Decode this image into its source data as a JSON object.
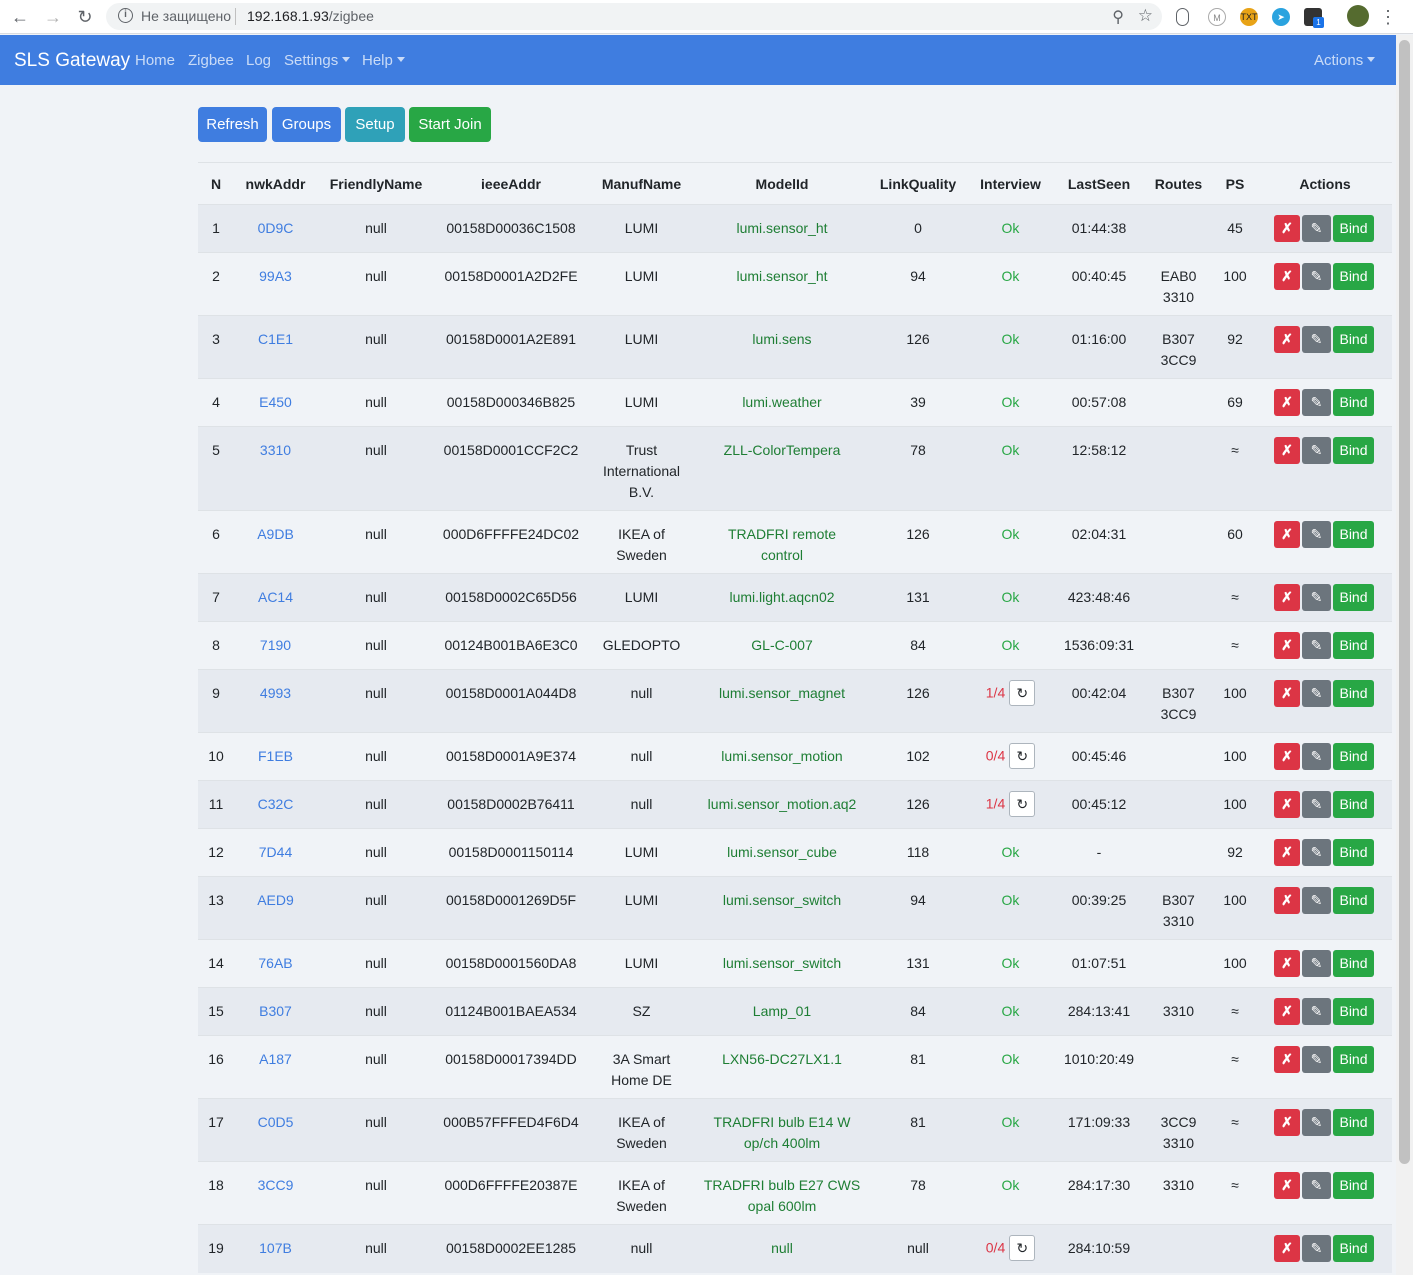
{
  "browser": {
    "security_text": "Не защищено",
    "url_host": "192.168.1.93",
    "url_path": "/zigbee",
    "badge_count": "1"
  },
  "navbar": {
    "brand": "SLS Gateway",
    "links": [
      "Home",
      "Zigbee",
      "Log",
      "Settings",
      "Help"
    ],
    "actions": "Actions"
  },
  "toolbar": {
    "refresh": "Refresh",
    "groups": "Groups",
    "setup": "Setup",
    "start_join": "Start Join"
  },
  "table": {
    "headers": [
      "N",
      "nwkAddr",
      "FriendlyName",
      "ieeeAddr",
      "ManufName",
      "ModelId",
      "LinkQuality",
      "Interview",
      "LastSeen",
      "Routes",
      "PS",
      "Actions"
    ],
    "action_labels": {
      "delete": "✗",
      "edit": "✎",
      "bind": "Bind"
    },
    "retry_icon": "↻",
    "rows": [
      {
        "n": "1",
        "nwk": "0D9C",
        "friendly": "null",
        "ieee": "00158D00036C1508",
        "manuf": "LUMI",
        "model": "lumi.sensor_ht",
        "lq": "0",
        "interview": "Ok",
        "interview_ok": true,
        "lastseen": "01:44:38",
        "routes": "",
        "ps": "45"
      },
      {
        "n": "2",
        "nwk": "99A3",
        "friendly": "null",
        "ieee": "00158D0001A2D2FE",
        "manuf": "LUMI",
        "model": "lumi.sensor_ht",
        "lq": "94",
        "interview": "Ok",
        "interview_ok": true,
        "lastseen": "00:40:45",
        "routes": "EAB0\n3310",
        "ps": "100"
      },
      {
        "n": "3",
        "nwk": "C1E1",
        "friendly": "null",
        "ieee": "00158D0001A2E891",
        "manuf": "LUMI",
        "model": "lumi.sens",
        "lq": "126",
        "interview": "Ok",
        "interview_ok": true,
        "lastseen": "01:16:00",
        "routes": "B307\n3CC9",
        "ps": "92"
      },
      {
        "n": "4",
        "nwk": "E450",
        "friendly": "null",
        "ieee": "00158D000346B825",
        "manuf": "LUMI",
        "model": "lumi.weather",
        "lq": "39",
        "interview": "Ok",
        "interview_ok": true,
        "lastseen": "00:57:08",
        "routes": "",
        "ps": "69"
      },
      {
        "n": "5",
        "nwk": "3310",
        "friendly": "null",
        "ieee": "00158D0001CCF2C2",
        "manuf": "Trust\nInternational\nB.V.",
        "model": "ZLL-ColorTempera",
        "lq": "78",
        "interview": "Ok",
        "interview_ok": true,
        "lastseen": "12:58:12",
        "routes": "",
        "ps": "≈"
      },
      {
        "n": "6",
        "nwk": "A9DB",
        "friendly": "null",
        "ieee": "000D6FFFFE24DC02",
        "manuf": "IKEA of\nSweden",
        "model": "TRADFRI remote\ncontrol",
        "lq": "126",
        "interview": "Ok",
        "interview_ok": true,
        "lastseen": "02:04:31",
        "routes": "",
        "ps": "60"
      },
      {
        "n": "7",
        "nwk": "AC14",
        "friendly": "null",
        "ieee": "00158D0002C65D56",
        "manuf": "LUMI",
        "model": "lumi.light.aqcn02",
        "lq": "131",
        "interview": "Ok",
        "interview_ok": true,
        "lastseen": "423:48:46",
        "routes": "",
        "ps": "≈"
      },
      {
        "n": "8",
        "nwk": "7190",
        "friendly": "null",
        "ieee": "00124B001BA6E3C0",
        "manuf": "GLEDOPTO",
        "model": "GL-C-007",
        "lq": "84",
        "interview": "Ok",
        "interview_ok": true,
        "lastseen": "1536:09:31",
        "routes": "",
        "ps": "≈"
      },
      {
        "n": "9",
        "nwk": "4993",
        "friendly": "null",
        "ieee": "00158D0001A044D8",
        "manuf": "null",
        "model": "lumi.sensor_magnet",
        "lq": "126",
        "interview": "1/4",
        "interview_ok": false,
        "lastseen": "00:42:04",
        "routes": "B307\n3CC9",
        "ps": "100"
      },
      {
        "n": "10",
        "nwk": "F1EB",
        "friendly": "null",
        "ieee": "00158D0001A9E374",
        "manuf": "null",
        "model": "lumi.sensor_motion",
        "lq": "102",
        "interview": "0/4",
        "interview_ok": false,
        "lastseen": "00:45:46",
        "routes": "",
        "ps": "100"
      },
      {
        "n": "11",
        "nwk": "C32C",
        "friendly": "null",
        "ieee": "00158D0002B76411",
        "manuf": "null",
        "model": "lumi.sensor_motion.aq2",
        "lq": "126",
        "interview": "1/4",
        "interview_ok": false,
        "lastseen": "00:45:12",
        "routes": "",
        "ps": "100"
      },
      {
        "n": "12",
        "nwk": "7D44",
        "friendly": "null",
        "ieee": "00158D0001150114",
        "manuf": "LUMI",
        "model": "lumi.sensor_cube",
        "lq": "118",
        "interview": "Ok",
        "interview_ok": true,
        "lastseen": "-",
        "routes": "",
        "ps": "92"
      },
      {
        "n": "13",
        "nwk": "AED9",
        "friendly": "null",
        "ieee": "00158D0001269D5F",
        "manuf": "LUMI",
        "model": "lumi.sensor_switch",
        "lq": "94",
        "interview": "Ok",
        "interview_ok": true,
        "lastseen": "00:39:25",
        "routes": "B307\n3310",
        "ps": "100"
      },
      {
        "n": "14",
        "nwk": "76AB",
        "friendly": "null",
        "ieee": "00158D0001560DA8",
        "manuf": "LUMI",
        "model": "lumi.sensor_switch",
        "lq": "131",
        "interview": "Ok",
        "interview_ok": true,
        "lastseen": "01:07:51",
        "routes": "",
        "ps": "100"
      },
      {
        "n": "15",
        "nwk": "B307",
        "friendly": "null",
        "ieee": "01124B001BAEA534",
        "manuf": "SZ",
        "model": "Lamp_01",
        "lq": "84",
        "interview": "Ok",
        "interview_ok": true,
        "lastseen": "284:13:41",
        "routes": "3310",
        "ps": "≈"
      },
      {
        "n": "16",
        "nwk": "A187",
        "friendly": "null",
        "ieee": "00158D00017394DD",
        "manuf": "3A Smart\nHome DE",
        "model": "LXN56-DC27LX1.1",
        "lq": "81",
        "interview": "Ok",
        "interview_ok": true,
        "lastseen": "1010:20:49",
        "routes": "",
        "ps": "≈"
      },
      {
        "n": "17",
        "nwk": "C0D5",
        "friendly": "null",
        "ieee": "000B57FFFED4F6D4",
        "manuf": "IKEA of\nSweden",
        "model": "TRADFRI bulb E14 W\nop/ch 400lm",
        "lq": "81",
        "interview": "Ok",
        "interview_ok": true,
        "lastseen": "171:09:33",
        "routes": "3CC9\n3310",
        "ps": "≈"
      },
      {
        "n": "18",
        "nwk": "3CC9",
        "friendly": "null",
        "ieee": "000D6FFFFE20387E",
        "manuf": "IKEA of\nSweden",
        "model": "TRADFRI bulb E27 CWS\nopal 600lm",
        "lq": "78",
        "interview": "Ok",
        "interview_ok": true,
        "lastseen": "284:17:30",
        "routes": "3310",
        "ps": "≈"
      },
      {
        "n": "19",
        "nwk": "107B",
        "friendly": "null",
        "ieee": "00158D0002EE1285",
        "manuf": "null",
        "model": "null",
        "lq": "null",
        "interview": "0/4",
        "interview_ok": false,
        "lastseen": "284:10:59",
        "routes": "",
        "ps": ""
      }
    ]
  }
}
